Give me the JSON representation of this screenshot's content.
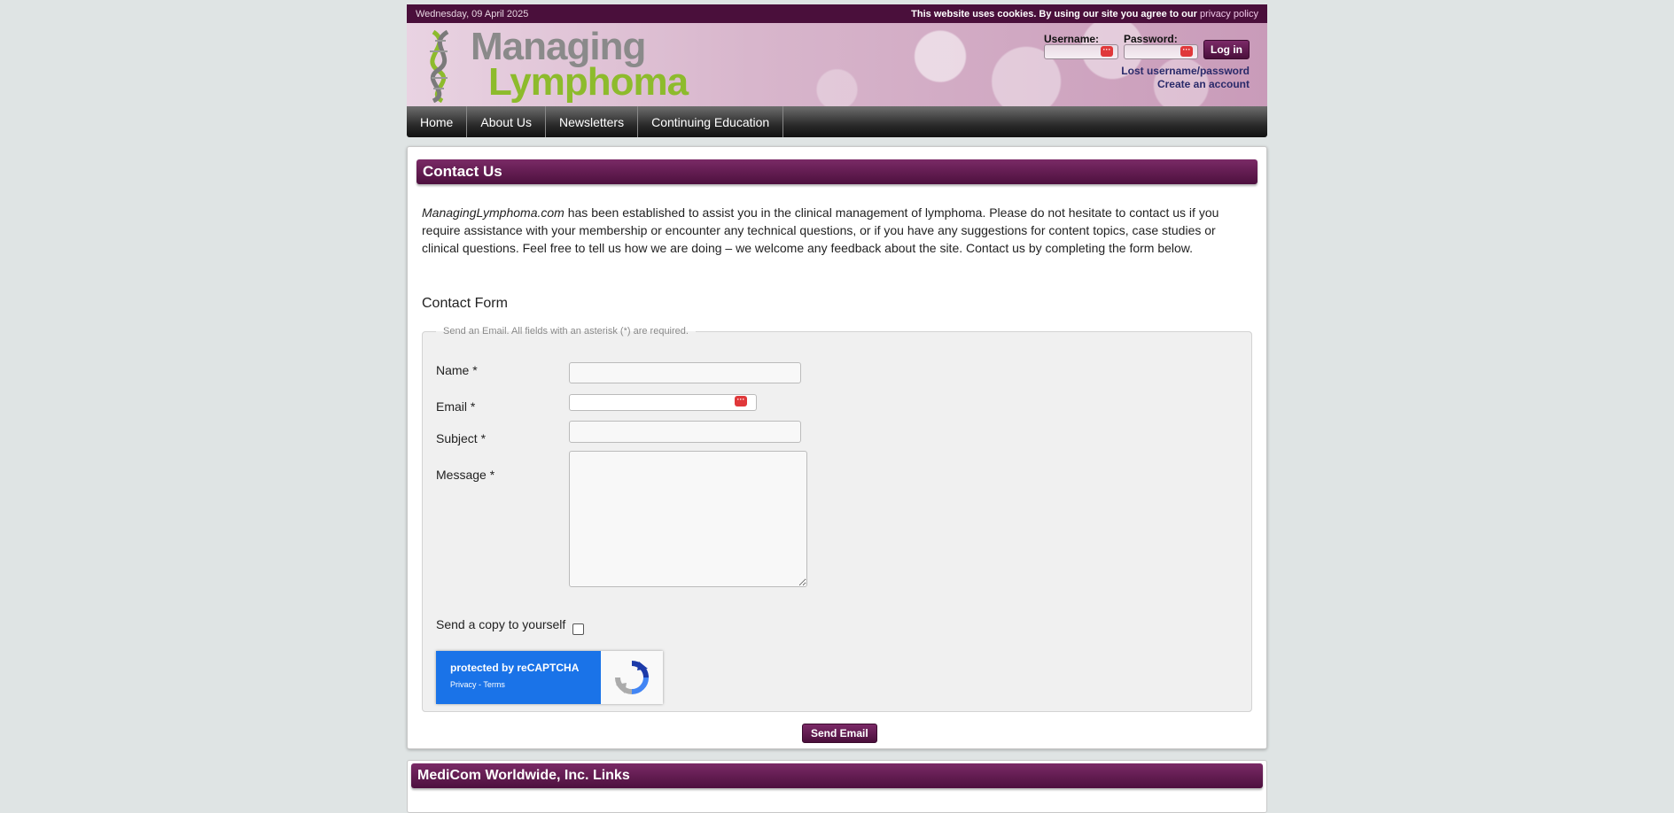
{
  "topbar": {
    "date": "Wednesday, 09 April 2025",
    "cookie_text": "This website uses cookies. By using our site you agree to our",
    "cookie_link": "privacy policy"
  },
  "logo": {
    "word1": "Managing",
    "word2": "Lymphoma"
  },
  "login": {
    "username_label": "Username:",
    "password_label": "Password:",
    "login_button": "Log in",
    "lost_link": "Lost username/password",
    "create_link": "Create an account"
  },
  "nav": {
    "items": [
      "Home",
      "About Us",
      "Newsletters",
      "Continuing Education"
    ]
  },
  "contact": {
    "title": "Contact Us",
    "intro_em": "ManagingLymphoma.com",
    "intro_rest": " has been established to assist you in the clinical management of lymphoma. Please do not hesitate to contact us if you require assistance with your membership or encounter any technical questions, or if you have any suggestions for content topics, case studies or clinical questions. Feel free to tell us how we are doing – we welcome any feedback about the site. Contact us by completing the form below.",
    "form_title": "Contact Form",
    "legend": "Send an Email. All fields with an asterisk (*) are required.",
    "name_label": "Name *",
    "email_label": "Email *",
    "subject_label": "Subject *",
    "message_label": "Message *",
    "copy_label": "Send a copy to yourself",
    "captcha_text": "protected by reCAPTCHA",
    "captcha_links": "Privacy - Terms",
    "send_button": "Send Email"
  },
  "links_panel": {
    "title": "MediCom Worldwide, Inc. Links"
  },
  "colors": {
    "brand": "#4a0f3b",
    "accent_green": "#8dbb2c",
    "captcha_blue": "#1a73e8"
  }
}
